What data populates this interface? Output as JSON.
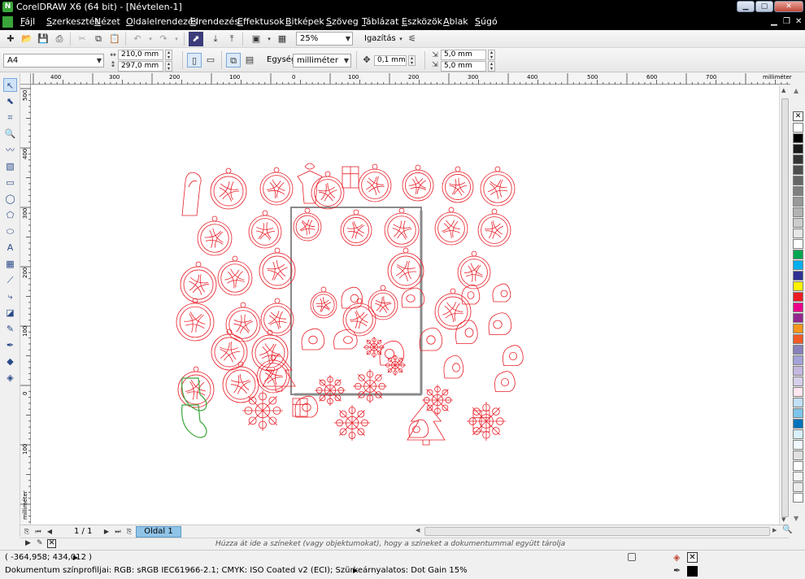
{
  "window": {
    "title": "CorelDRAW X6 (64 bit) - [Névtelen-1]",
    "app_icon": "N"
  },
  "menu": [
    {
      "label": "Fájl"
    },
    {
      "label": "Szerkesztés"
    },
    {
      "label": "Nézet"
    },
    {
      "label": "Oldalelrendezés"
    },
    {
      "label": "Elrendezés"
    },
    {
      "label": "Effektusok"
    },
    {
      "label": "Bitképek"
    },
    {
      "label": "Szöveg"
    },
    {
      "label": "Táblázat"
    },
    {
      "label": "Eszközök"
    },
    {
      "label": "Ablak"
    },
    {
      "label": "Súgó"
    }
  ],
  "toolbar": {
    "zoom_value": "25%",
    "snap_label": "Igazítás"
  },
  "property_bar": {
    "page_size": "A4",
    "width": "210,0 mm",
    "height": "297,0 mm",
    "units_label": "Egység:",
    "units_value": "milliméter",
    "nudge": "0,1 mm",
    "dup_x": "5,0 mm",
    "dup_y": "5,0 mm"
  },
  "ruler": {
    "top_ticks": [
      "400",
      "300",
      "200",
      "100",
      "0",
      "100",
      "200",
      "300",
      "400",
      "500",
      "600",
      "700"
    ],
    "top_unit": "milliméter",
    "left_ticks": [
      "500",
      "400",
      "300",
      "200",
      "100",
      "0",
      "100"
    ],
    "left_unit": "milliméter"
  },
  "page_nav": {
    "counter": "1 / 1",
    "tab_label": "Oldal 1"
  },
  "hint": "Húzza át ide a színeket (vagy objektumokat), hogy a színeket a dokumentummal együtt tárolja",
  "status": {
    "coords": "( -364,958; 434,012 )",
    "color_profile": "Dokumentum színprofiljai: RGB: sRGB IEC61966-2.1; CMYK: ISO Coated v2 (ECI); Szürkeárnyalatos: Dot Gain 15%"
  },
  "colors": {
    "outline_red": "#e8202a",
    "outline_green": "#3aa53a",
    "page_tab": "#8fc3e7"
  },
  "palette": [
    "#ffffff",
    "#000000",
    "#1a1a1a",
    "#333333",
    "#4d4d4d",
    "#666666",
    "#808080",
    "#999999",
    "#b3b3b3",
    "#cccccc",
    "#e6e6e6",
    "#ffffff",
    "#00a651",
    "#00aeef",
    "#2e3192",
    "#fff200",
    "#ed1c24",
    "#ec008c",
    "#92278f",
    "#f7941d",
    "#f15a24",
    "#8781bd",
    "#a3a3d9",
    "#c4b7e0",
    "#d6cfeb",
    "#ffe6f0",
    "#c2e0f4",
    "#7dc4ea",
    "#0072bc",
    "#d9f0fa",
    "#f0f8ff",
    "#e0e0e0",
    "#ffffff",
    "#f5f5f5",
    "#ebebeb",
    "#ffffff"
  ]
}
